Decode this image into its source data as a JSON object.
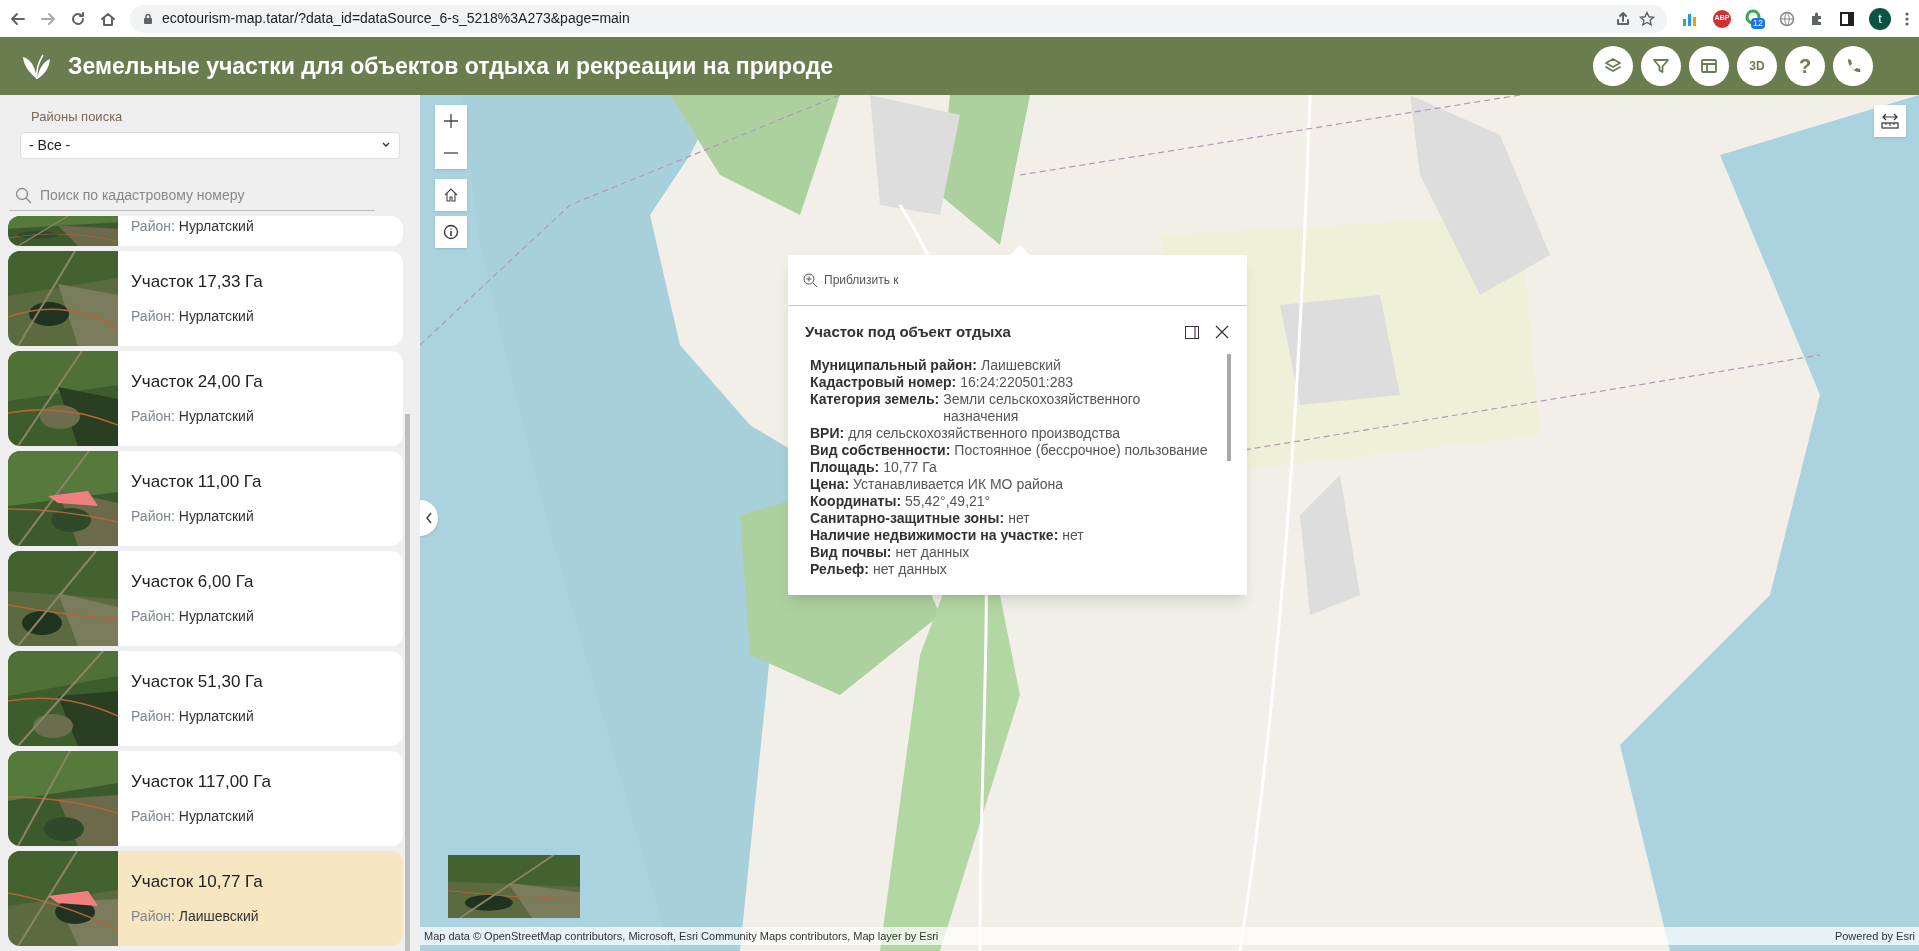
{
  "browser": {
    "url": "ecotourism-map.tatar/?data_id=dataSource_6-s_5218%3A273&page=main",
    "extension_badges": [
      "ABP",
      "12"
    ],
    "profile_initial": "t"
  },
  "header": {
    "title": "Земельные участки для объектов отдыха и рекреации на природе",
    "buttons": [
      {
        "kind": "layers"
      },
      {
        "kind": "filter"
      },
      {
        "kind": "table"
      },
      {
        "kind": "text",
        "label": "3D"
      },
      {
        "kind": "text",
        "label": "?"
      },
      {
        "kind": "phone"
      }
    ]
  },
  "sidebar": {
    "district_filter": {
      "label": "Районы поиска",
      "value": "- Все -"
    },
    "search": {
      "placeholder": "Поиск по кадастровому номеру"
    },
    "cards": [
      {
        "kind": "partial",
        "district_label": "Район:",
        "district": "Нурлатский",
        "selected": false
      },
      {
        "kind": "full",
        "title": "Участок 17,33 Га",
        "district_label": "Район:",
        "district": "Нурлатский",
        "selected": false
      },
      {
        "kind": "full",
        "title": "Участок 24,00 Га",
        "district_label": "Район:",
        "district": "Нурлатский",
        "selected": false
      },
      {
        "kind": "full",
        "title": "Участок 11,00 Га",
        "district_label": "Район:",
        "district": "Нурлатский",
        "selected": false
      },
      {
        "kind": "full",
        "title": "Участок 6,00 Га",
        "district_label": "Район:",
        "district": "Нурлатский",
        "selected": false
      },
      {
        "kind": "full",
        "title": "Участок 51,30 Га",
        "district_label": "Район:",
        "district": "Нурлатский",
        "selected": false
      },
      {
        "kind": "full",
        "title": "Участок 117,00 Га",
        "district_label": "Район:",
        "district": "Нурлатский",
        "selected": false
      },
      {
        "kind": "full",
        "title": "Участок 10,77 Га",
        "district_label": "Район:",
        "district": "Лаишевский",
        "selected": true
      }
    ]
  },
  "map": {
    "popup": {
      "zoom_action": "Приблизить к",
      "title": "Участок под объект отдыха",
      "fields": [
        {
          "label": "Муниципальный район:",
          "value": "Лаишевский"
        },
        {
          "label": "Кадастровый номер:",
          "value": "16:24:220501:283"
        },
        {
          "label": "Категория земель:",
          "value": "Земли сельскохозяйственного назначения"
        },
        {
          "label": "ВРИ:",
          "value": "для сельскохозяйственного производства"
        },
        {
          "label": "Вид собственности:",
          "value": "Постоянное (бессрочное) пользование"
        },
        {
          "label": "Площадь:",
          "value": "10,77 Га"
        },
        {
          "label": "Цена:",
          "value": "Устанавливается ИК МО района"
        },
        {
          "label": "Координаты:",
          "value": "55,42°,49,21°"
        },
        {
          "label": "Санитарно-защитные зоны:",
          "value": "нет"
        },
        {
          "label": "Наличие недвижимости на участке:",
          "value": "нет"
        },
        {
          "label": "Вид почвы:",
          "value": "нет данных"
        },
        {
          "label": "Рельеф:",
          "value": "нет данных"
        }
      ]
    },
    "attribution": "Map data © OpenStreetMap contributors, Microsoft, Esri Community Maps contributors, Map layer by Esri",
    "powered_by": "Powered by Esri"
  }
}
